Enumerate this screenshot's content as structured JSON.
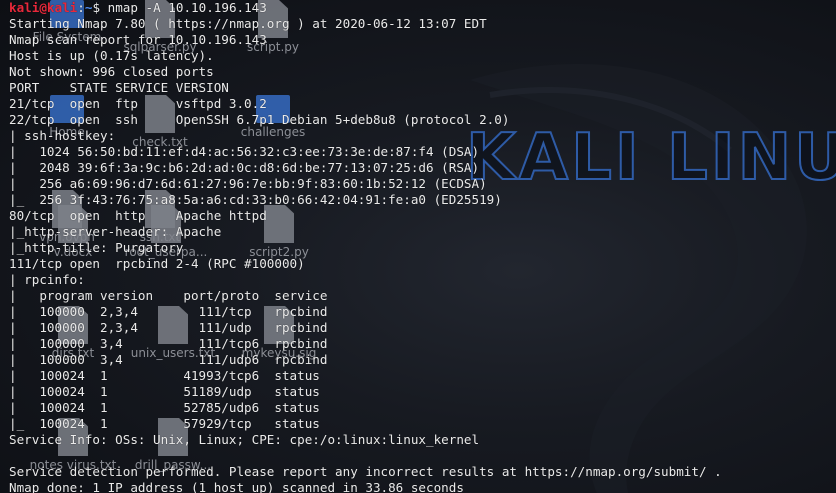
{
  "wallpaper": {
    "logo_text": "KALI LINUX",
    "accent_color": "#2e5ba6"
  },
  "desktop_icons": [
    {
      "label": "File System",
      "kind": "folder"
    },
    {
      "label": "Home",
      "kind": "folder"
    },
    {
      "label": "sqlparser.py",
      "kind": "file"
    },
    {
      "label": "script.py",
      "kind": "file"
    },
    {
      "label": "check.txt",
      "kind": "file"
    },
    {
      "label": "vpn.ovpn",
      "kind": "file"
    },
    {
      "label": "ssh.txt",
      "kind": "file"
    },
    {
      "label": "challenges",
      "kind": "folder"
    },
    {
      "label": "v.docx",
      "kind": "file"
    },
    {
      "label": "root_userpa...",
      "kind": "file"
    },
    {
      "label": "script2.py",
      "kind": "file"
    },
    {
      "label": "dirs.txt",
      "kind": "file"
    },
    {
      "label": "unix_users.txt",
      "kind": "file"
    },
    {
      "label": "mykeysu.sig",
      "kind": "file"
    },
    {
      "label": "notes virus.txt",
      "kind": "file"
    },
    {
      "label": "drill_passw...",
      "kind": "file"
    }
  ],
  "terminal": {
    "prompt": {
      "user": "kali@kali",
      "separator": ":",
      "path": "~",
      "symbol": "$",
      "command": "nmap -A 10.10.196.143"
    },
    "lines": [
      "Starting Nmap 7.80 ( https://nmap.org ) at 2020-06-12 13:07 EDT",
      "Nmap scan report for 10.10.196.143",
      "Host is up (0.17s latency).",
      "Not shown: 996 closed ports",
      "PORT    STATE SERVICE VERSION",
      "21/tcp  open  ftp     vsftpd 3.0.2",
      "22/tcp  open  ssh     OpenSSH 6.7p1 Debian 5+deb8u8 (protocol 2.0)",
      "| ssh-hostkey: ",
      "|   1024 56:50:bd:11:ef:d4:ac:56:32:c3:ee:73:3e:de:87:f4 (DSA)",
      "|   2048 39:6f:3a:9c:b6:2d:ad:0c:d8:6d:be:77:13:07:25:d6 (RSA)",
      "|   256 a6:69:96:d7:6d:61:27:96:7e:bb:9f:83:60:1b:52:12 (ECDSA)",
      "|_  256 3f:43:76:75:a8:5a:a6:cd:33:b0:66:42:04:91:fe:a0 (ED25519)",
      "80/tcp  open  http    Apache httpd",
      "|_http-server-header: Apache",
      "|_http-title: Purgatory",
      "111/tcp open  rpcbind 2-4 (RPC #100000)",
      "| rpcinfo: ",
      "|   program version    port/proto  service",
      "|   100000  2,3,4        111/tcp   rpcbind",
      "|   100000  2,3,4        111/udp   rpcbind",
      "|   100000  3,4          111/tcp6  rpcbind",
      "|   100000  3,4          111/udp6  rpcbind",
      "|   100024  1          41993/tcp6  status",
      "|   100024  1          51189/udp   status",
      "|   100024  1          52785/udp6  status",
      "|_  100024  1          57929/tcp   status",
      "Service Info: OSs: Unix, Linux; CPE: cpe:/o:linux:linux_kernel",
      "",
      "Service detection performed. Please report any incorrect results at https://nmap.org/submit/ .",
      "Nmap done: 1 IP address (1 host up) scanned in 33.86 seconds"
    ]
  }
}
